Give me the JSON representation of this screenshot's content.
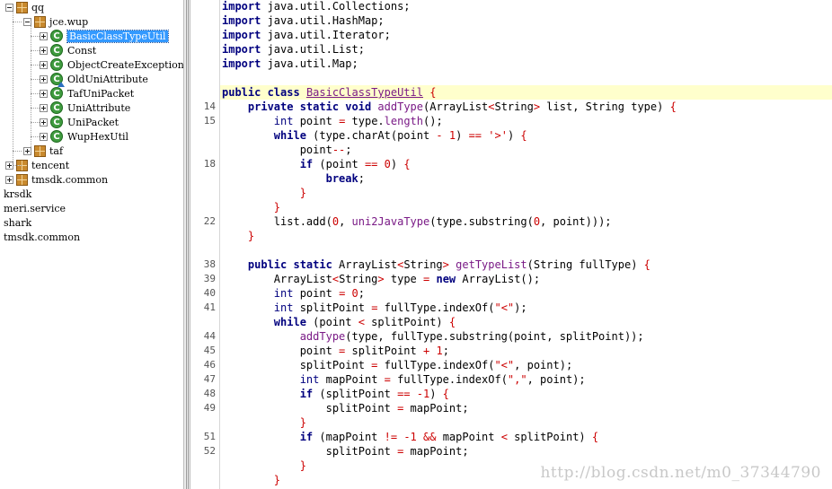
{
  "tree": {
    "items": [
      {
        "label": "qq",
        "depth": 0,
        "kind": "package",
        "expander": "minus"
      },
      {
        "label": "jce.wup",
        "depth": 1,
        "kind": "package",
        "expander": "minus"
      },
      {
        "label": "BasicClassTypeUtil",
        "depth": 2,
        "kind": "class",
        "expander": "plus",
        "selected": true
      },
      {
        "label": "Const",
        "depth": 2,
        "kind": "class",
        "expander": "plus"
      },
      {
        "label": "ObjectCreateException",
        "depth": 2,
        "kind": "class",
        "expander": "plus"
      },
      {
        "label": "OldUniAttribute",
        "depth": 2,
        "kind": "class-abstract",
        "expander": "plus"
      },
      {
        "label": "TafUniPacket",
        "depth": 2,
        "kind": "class",
        "expander": "plus"
      },
      {
        "label": "UniAttribute",
        "depth": 2,
        "kind": "class",
        "expander": "plus"
      },
      {
        "label": "UniPacket",
        "depth": 2,
        "kind": "class",
        "expander": "plus"
      },
      {
        "label": "WupHexUtil",
        "depth": 2,
        "kind": "class",
        "expander": "plus"
      },
      {
        "label": "taf",
        "depth": 1,
        "kind": "package",
        "expander": "plus"
      },
      {
        "label": "tencent",
        "depth": 0,
        "kind": "package",
        "expander": "plus"
      },
      {
        "label": "tmsdk.common",
        "depth": 0,
        "kind": "package",
        "expander": "plus"
      },
      {
        "label": "krsdk",
        "depth": -1,
        "kind": "root"
      },
      {
        "label": "meri.service",
        "depth": -1,
        "kind": "root"
      },
      {
        "label": "shark",
        "depth": -1,
        "kind": "root"
      },
      {
        "label": "tmsdk.common",
        "depth": -1,
        "kind": "root"
      }
    ]
  },
  "editor": {
    "lines": [
      {
        "ln": "",
        "code": "import java.util.Collections;",
        "tokens": [
          [
            "kw",
            "import"
          ],
          [
            "p",
            " java.util.Collections;"
          ]
        ]
      },
      {
        "ln": "",
        "code": "import java.util.HashMap;",
        "tokens": [
          [
            "kw",
            "import"
          ],
          [
            "p",
            " java.util.HashMap;"
          ]
        ]
      },
      {
        "ln": "",
        "code": "import java.util.Iterator;",
        "tokens": [
          [
            "kw",
            "import"
          ],
          [
            "p",
            " java.util.Iterator;"
          ]
        ]
      },
      {
        "ln": "",
        "code": "import java.util.List;",
        "tokens": [
          [
            "kw",
            "import"
          ],
          [
            "p",
            " java.util.List;"
          ]
        ]
      },
      {
        "ln": "",
        "code": "import java.util.Map;",
        "tokens": [
          [
            "kw",
            "import"
          ],
          [
            "p",
            " java.util.Map;"
          ]
        ]
      },
      {
        "ln": "",
        "code": "",
        "tokens": []
      },
      {
        "ln": "",
        "code": "public class BasicClassTypeUtil {",
        "hl": true,
        "tokens": [
          [
            "kw",
            "public class"
          ],
          [
            "p",
            " "
          ],
          [
            "cls",
            "BasicClassTypeUtil"
          ],
          [
            "p",
            " "
          ],
          [
            "br",
            "{"
          ]
        ]
      },
      {
        "ln": "14",
        "code": "    private static void addType(ArrayList<String> list, String type) {",
        "tokens": [
          [
            "p",
            "    "
          ],
          [
            "kw",
            "private static void"
          ],
          [
            "p",
            " "
          ],
          [
            "fn",
            "addType"
          ],
          [
            "p",
            "(ArrayList"
          ],
          [
            "op",
            "<"
          ],
          [
            "p",
            "String"
          ],
          [
            "op",
            ">"
          ],
          [
            "p",
            " list, String type) "
          ],
          [
            "br",
            "{"
          ]
        ]
      },
      {
        "ln": "15",
        "code": "        int point = type.length();",
        "tokens": [
          [
            "p",
            "        "
          ],
          [
            "type",
            "int"
          ],
          [
            "p",
            " point "
          ],
          [
            "op",
            "="
          ],
          [
            "p",
            " type."
          ],
          [
            "fn",
            "length"
          ],
          [
            "p",
            "();"
          ]
        ]
      },
      {
        "ln": "",
        "code": "        while (type.charAt(point - 1) == '>') {",
        "tokens": [
          [
            "p",
            "        "
          ],
          [
            "kw",
            "while"
          ],
          [
            "p",
            " (type.charAt(point "
          ],
          [
            "op",
            "-"
          ],
          [
            "p",
            " "
          ],
          [
            "num",
            "1"
          ],
          [
            "p",
            ") "
          ],
          [
            "op",
            "=="
          ],
          [
            "p",
            " "
          ],
          [
            "str",
            "'>'"
          ],
          [
            "p",
            ") "
          ],
          [
            "br",
            "{"
          ]
        ]
      },
      {
        "ln": "",
        "code": "            point--;",
        "tokens": [
          [
            "p",
            "            point"
          ],
          [
            "op",
            "--"
          ],
          [
            "p",
            ";"
          ]
        ]
      },
      {
        "ln": "18",
        "code": "            if (point == 0) {",
        "tokens": [
          [
            "p",
            "            "
          ],
          [
            "kw",
            "if"
          ],
          [
            "p",
            " (point "
          ],
          [
            "op",
            "=="
          ],
          [
            "p",
            " "
          ],
          [
            "num",
            "0"
          ],
          [
            "p",
            ") "
          ],
          [
            "br",
            "{"
          ]
        ]
      },
      {
        "ln": "",
        "code": "                break;",
        "tokens": [
          [
            "p",
            "                "
          ],
          [
            "kw",
            "break"
          ],
          [
            "p",
            ";"
          ]
        ]
      },
      {
        "ln": "",
        "code": "            }",
        "tokens": [
          [
            "p",
            "            "
          ],
          [
            "br",
            "}"
          ]
        ]
      },
      {
        "ln": "",
        "code": "        }",
        "tokens": [
          [
            "p",
            "        "
          ],
          [
            "br",
            "}"
          ]
        ]
      },
      {
        "ln": "22",
        "code": "        list.add(0, uni2JavaType(type.substring(0, point)));",
        "tokens": [
          [
            "p",
            "        list.add("
          ],
          [
            "num",
            "0"
          ],
          [
            "p",
            ", "
          ],
          [
            "fn",
            "uni2JavaType"
          ],
          [
            "p",
            "(type.substring("
          ],
          [
            "num",
            "0"
          ],
          [
            "p",
            ", point)));"
          ]
        ]
      },
      {
        "ln": "",
        "code": "    }",
        "tokens": [
          [
            "p",
            "    "
          ],
          [
            "br",
            "}"
          ]
        ]
      },
      {
        "ln": "",
        "code": "",
        "tokens": []
      },
      {
        "ln": "38",
        "code": "    public static ArrayList<String> getTypeList(String fullType) {",
        "tokens": [
          [
            "p",
            "    "
          ],
          [
            "kw",
            "public static"
          ],
          [
            "p",
            " ArrayList"
          ],
          [
            "op",
            "<"
          ],
          [
            "p",
            "String"
          ],
          [
            "op",
            ">"
          ],
          [
            "p",
            " "
          ],
          [
            "fn",
            "getTypeList"
          ],
          [
            "p",
            "(String fullType) "
          ],
          [
            "br",
            "{"
          ]
        ]
      },
      {
        "ln": "39",
        "code": "        ArrayList<String> type = new ArrayList();",
        "tokens": [
          [
            "p",
            "        ArrayList"
          ],
          [
            "op",
            "<"
          ],
          [
            "p",
            "String"
          ],
          [
            "op",
            ">"
          ],
          [
            "p",
            " type "
          ],
          [
            "op",
            "="
          ],
          [
            "p",
            " "
          ],
          [
            "kw",
            "new"
          ],
          [
            "p",
            " ArrayList();"
          ]
        ]
      },
      {
        "ln": "40",
        "code": "        int point = 0;",
        "tokens": [
          [
            "p",
            "        "
          ],
          [
            "type",
            "int"
          ],
          [
            "p",
            " point "
          ],
          [
            "op",
            "="
          ],
          [
            "p",
            " "
          ],
          [
            "num",
            "0"
          ],
          [
            "p",
            ";"
          ]
        ]
      },
      {
        "ln": "41",
        "code": "        int splitPoint = fullType.indexOf(\"<\");",
        "tokens": [
          [
            "p",
            "        "
          ],
          [
            "type",
            "int"
          ],
          [
            "p",
            " splitPoint "
          ],
          [
            "op",
            "="
          ],
          [
            "p",
            " fullType.indexOf("
          ],
          [
            "str",
            "\"<\""
          ],
          [
            "p",
            ");"
          ]
        ]
      },
      {
        "ln": "",
        "code": "        while (point < splitPoint) {",
        "tokens": [
          [
            "p",
            "        "
          ],
          [
            "kw",
            "while"
          ],
          [
            "p",
            " (point "
          ],
          [
            "op",
            "<"
          ],
          [
            "p",
            " splitPoint) "
          ],
          [
            "br",
            "{"
          ]
        ]
      },
      {
        "ln": "44",
        "code": "            addType(type, fullType.substring(point, splitPoint));",
        "tokens": [
          [
            "p",
            "            "
          ],
          [
            "fn",
            "addType"
          ],
          [
            "p",
            "(type, fullType.substring(point, splitPoint));"
          ]
        ]
      },
      {
        "ln": "45",
        "code": "            point = splitPoint + 1;",
        "tokens": [
          [
            "p",
            "            point "
          ],
          [
            "op",
            "="
          ],
          [
            "p",
            " splitPoint "
          ],
          [
            "op",
            "+"
          ],
          [
            "p",
            " "
          ],
          [
            "num",
            "1"
          ],
          [
            "p",
            ";"
          ]
        ]
      },
      {
        "ln": "46",
        "code": "            splitPoint = fullType.indexOf(\"<\", point);",
        "tokens": [
          [
            "p",
            "            splitPoint "
          ],
          [
            "op",
            "="
          ],
          [
            "p",
            " fullType.indexOf("
          ],
          [
            "str",
            "\"<\""
          ],
          [
            "p",
            ", point);"
          ]
        ]
      },
      {
        "ln": "47",
        "code": "            int mapPoint = fullType.indexOf(\",\", point);",
        "tokens": [
          [
            "p",
            "            "
          ],
          [
            "type",
            "int"
          ],
          [
            "p",
            " mapPoint "
          ],
          [
            "op",
            "="
          ],
          [
            "p",
            " fullType.indexOf("
          ],
          [
            "str",
            "\",\""
          ],
          [
            "p",
            ", point);"
          ]
        ]
      },
      {
        "ln": "48",
        "code": "            if (splitPoint == -1) {",
        "tokens": [
          [
            "p",
            "            "
          ],
          [
            "kw",
            "if"
          ],
          [
            "p",
            " (splitPoint "
          ],
          [
            "op",
            "=="
          ],
          [
            "p",
            " "
          ],
          [
            "num",
            "-1"
          ],
          [
            "p",
            ") "
          ],
          [
            "br",
            "{"
          ]
        ]
      },
      {
        "ln": "49",
        "code": "                splitPoint = mapPoint;",
        "tokens": [
          [
            "p",
            "                splitPoint "
          ],
          [
            "op",
            "="
          ],
          [
            "p",
            " mapPoint;"
          ]
        ]
      },
      {
        "ln": "",
        "code": "            }",
        "tokens": [
          [
            "p",
            "            "
          ],
          [
            "br",
            "}"
          ]
        ]
      },
      {
        "ln": "51",
        "code": "            if (mapPoint != -1 && mapPoint < splitPoint) {",
        "tokens": [
          [
            "p",
            "            "
          ],
          [
            "kw",
            "if"
          ],
          [
            "p",
            " (mapPoint "
          ],
          [
            "op",
            "!="
          ],
          [
            "p",
            " "
          ],
          [
            "num",
            "-1"
          ],
          [
            "p",
            " "
          ],
          [
            "op",
            "&&"
          ],
          [
            "p",
            " mapPoint "
          ],
          [
            "op",
            "<"
          ],
          [
            "p",
            " splitPoint) "
          ],
          [
            "br",
            "{"
          ]
        ]
      },
      {
        "ln": "52",
        "code": "                splitPoint = mapPoint;",
        "tokens": [
          [
            "p",
            "                splitPoint "
          ],
          [
            "op",
            "="
          ],
          [
            "p",
            " mapPoint;"
          ]
        ]
      },
      {
        "ln": "",
        "code": "            }",
        "tokens": [
          [
            "p",
            "            "
          ],
          [
            "br",
            "}"
          ]
        ]
      },
      {
        "ln": "",
        "code": "        }",
        "tokens": [
          [
            "p",
            "        "
          ],
          [
            "br",
            "}"
          ]
        ]
      }
    ]
  },
  "watermark": "http://blog.csdn.net/m0_37344790"
}
